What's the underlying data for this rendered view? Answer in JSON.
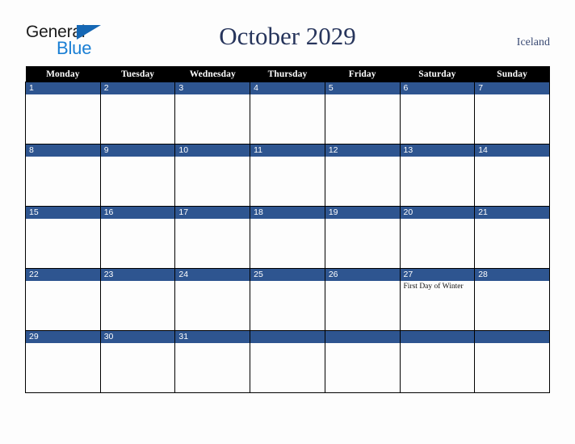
{
  "brand": {
    "name_part1": "General",
    "name_part2": "Blue",
    "triangle_color": "#1567b4",
    "blue_color": "#1a7fd4"
  },
  "header": {
    "title": "October 2029",
    "location": "Iceland",
    "title_color": "#27355c"
  },
  "calendar": {
    "month": "October",
    "year": "2029",
    "band_color": "#2e5590",
    "header_bg": "#000000",
    "weekdays": [
      "Monday",
      "Tuesday",
      "Wednesday",
      "Thursday",
      "Friday",
      "Saturday",
      "Sunday"
    ],
    "weeks": [
      [
        {
          "day": "1",
          "events": []
        },
        {
          "day": "2",
          "events": []
        },
        {
          "day": "3",
          "events": []
        },
        {
          "day": "4",
          "events": []
        },
        {
          "day": "5",
          "events": []
        },
        {
          "day": "6",
          "events": []
        },
        {
          "day": "7",
          "events": []
        }
      ],
      [
        {
          "day": "8",
          "events": []
        },
        {
          "day": "9",
          "events": []
        },
        {
          "day": "10",
          "events": []
        },
        {
          "day": "11",
          "events": []
        },
        {
          "day": "12",
          "events": []
        },
        {
          "day": "13",
          "events": []
        },
        {
          "day": "14",
          "events": []
        }
      ],
      [
        {
          "day": "15",
          "events": []
        },
        {
          "day": "16",
          "events": []
        },
        {
          "day": "17",
          "events": []
        },
        {
          "day": "18",
          "events": []
        },
        {
          "day": "19",
          "events": []
        },
        {
          "day": "20",
          "events": []
        },
        {
          "day": "21",
          "events": []
        }
      ],
      [
        {
          "day": "22",
          "events": []
        },
        {
          "day": "23",
          "events": []
        },
        {
          "day": "24",
          "events": []
        },
        {
          "day": "25",
          "events": []
        },
        {
          "day": "26",
          "events": []
        },
        {
          "day": "27",
          "events": [
            "First Day of Winter"
          ]
        },
        {
          "day": "28",
          "events": []
        }
      ],
      [
        {
          "day": "29",
          "events": []
        },
        {
          "day": "30",
          "events": []
        },
        {
          "day": "31",
          "events": []
        },
        {
          "day": "",
          "events": []
        },
        {
          "day": "",
          "events": []
        },
        {
          "day": "",
          "events": []
        },
        {
          "day": "",
          "events": []
        }
      ]
    ]
  }
}
